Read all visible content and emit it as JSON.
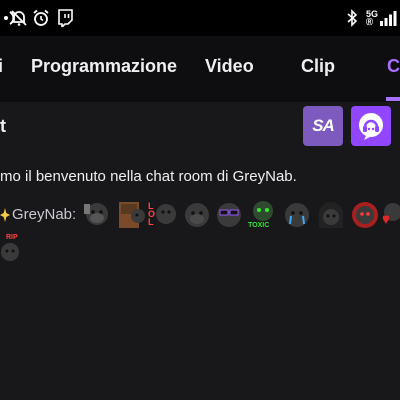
{
  "status_bar": {
    "network_type": "5G",
    "network_sub": "Ⓡ",
    "colors": {
      "bg": "#000000",
      "icon": "#ffffff"
    },
    "icons": [
      "hotspot-icon",
      "bell-muted-icon",
      "alarm-icon",
      "twitch-icon",
      "bluetooth-icon",
      "signal-icon"
    ]
  },
  "tabs": [
    {
      "label": "i"
    },
    {
      "label": "Programmazione"
    },
    {
      "label": "Video"
    },
    {
      "label": "Clip"
    },
    {
      "label": "C"
    }
  ],
  "active_tab_index": 4,
  "header": {
    "title": "t",
    "extension_1_label": "SA",
    "colors": {
      "accent": "#a970ff",
      "bg": "#18181b"
    }
  },
  "chat": {
    "welcome_text": "mo il benvenuto nella chat room di GreyNab.",
    "message": {
      "username": "GreyNab",
      "separator": ":",
      "emotes": [
        "gorilla-emote",
        "gorilla-door-emote",
        "lol-emote",
        "gorilla-emote",
        "gorilla-glasses-emote",
        "toxic-emote",
        "gorilla-cry-emote",
        "gorilla-hood-emote",
        "gorilla-rage-emote",
        "gorilla-heart-emote",
        "gorilla-hype-emote",
        "gorilla-rip-emote"
      ],
      "emote_texts": {
        "lol": "LOL",
        "toxic": "TOXIC",
        "hype": "HYP",
        "rip": "RIP"
      }
    }
  }
}
